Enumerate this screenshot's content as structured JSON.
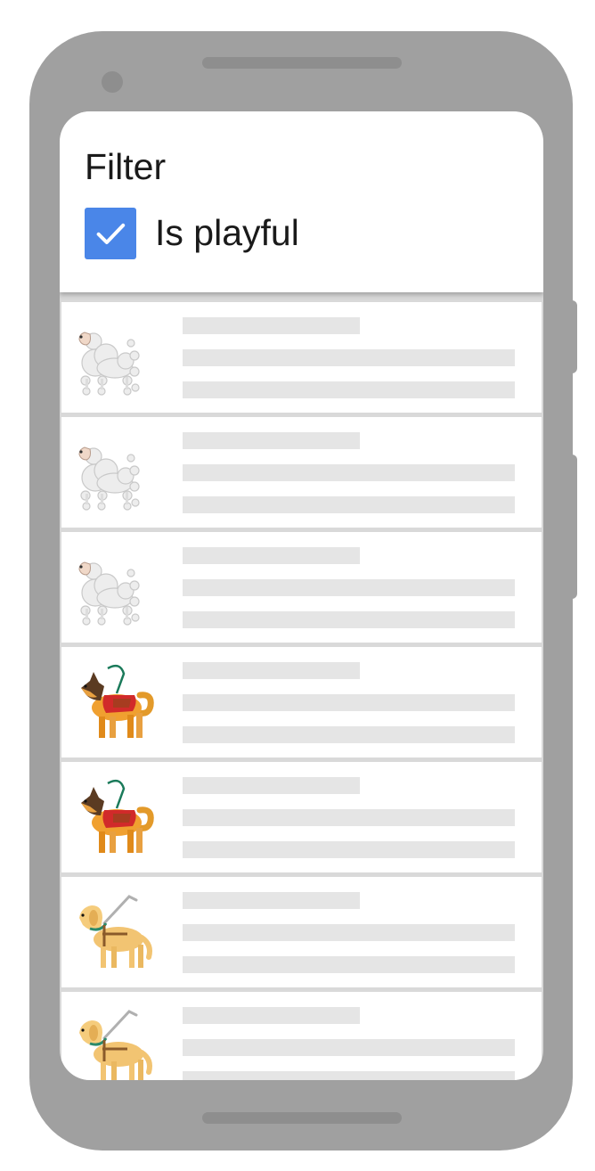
{
  "colors": {
    "device": "#a0a0a0",
    "checkbox": "#4a86e8",
    "placeholder_bar": "#e5e5e5",
    "divider": "#d9d9d9"
  },
  "filter": {
    "title": "Filter",
    "checkbox": {
      "label": "Is playful",
      "checked": true
    }
  },
  "results": [
    {
      "icon": "poodle-icon"
    },
    {
      "icon": "poodle-icon"
    },
    {
      "icon": "poodle-icon"
    },
    {
      "icon": "service-dog-icon"
    },
    {
      "icon": "service-dog-icon"
    },
    {
      "icon": "guide-dog-icon"
    },
    {
      "icon": "guide-dog-icon"
    }
  ]
}
